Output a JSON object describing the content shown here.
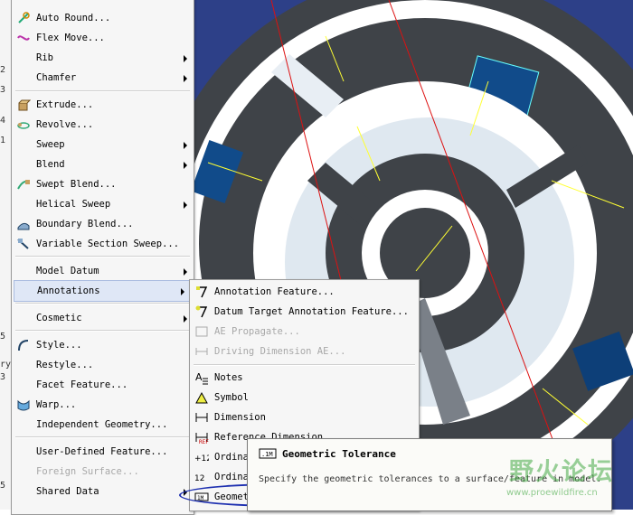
{
  "left_strip": {
    "fragments": [
      "2",
      "3",
      "4",
      "1",
      "5",
      "ry",
      "3",
      "5"
    ]
  },
  "main_menu": {
    "items": [
      {
        "label": "Auto Round...",
        "icon": "round-icon",
        "submenu": false
      },
      {
        "label": "Flex Move...",
        "icon": "flex-move-icon",
        "submenu": false
      },
      {
        "label": "Rib",
        "icon": "",
        "submenu": true
      },
      {
        "label": "Chamfer",
        "icon": "",
        "submenu": true
      },
      {
        "label": "Extrude...",
        "icon": "extrude-icon",
        "submenu": false
      },
      {
        "label": "Revolve...",
        "icon": "revolve-icon",
        "submenu": false
      },
      {
        "label": "Sweep",
        "icon": "",
        "submenu": true
      },
      {
        "label": "Blend",
        "icon": "",
        "submenu": true
      },
      {
        "label": "Swept Blend...",
        "icon": "swept-blend-icon",
        "submenu": false
      },
      {
        "label": "Helical Sweep",
        "icon": "",
        "submenu": true
      },
      {
        "label": "Boundary Blend...",
        "icon": "boundary-blend-icon",
        "submenu": false
      },
      {
        "label": "Variable Section Sweep...",
        "icon": "variable-sweep-icon",
        "submenu": false
      },
      {
        "label": "Model Datum",
        "icon": "",
        "submenu": true
      },
      {
        "label": "Annotations",
        "icon": "",
        "submenu": true,
        "highlighted": true
      },
      {
        "label": "Cosmetic",
        "icon": "",
        "submenu": true
      },
      {
        "label": "Style...",
        "icon": "style-icon",
        "submenu": false
      },
      {
        "label": "Restyle...",
        "icon": "",
        "submenu": false
      },
      {
        "label": "Facet Feature...",
        "icon": "",
        "submenu": false
      },
      {
        "label": "Warp...",
        "icon": "warp-icon",
        "submenu": false
      },
      {
        "label": "Independent Geometry...",
        "icon": "",
        "submenu": false
      },
      {
        "label": "User-Defined Feature...",
        "icon": "",
        "submenu": false
      },
      {
        "label": "Foreign Surface...",
        "icon": "",
        "submenu": false,
        "disabled": true
      },
      {
        "label": "Shared Data",
        "icon": "",
        "submenu": true
      }
    ]
  },
  "annotations_menu": {
    "items": [
      {
        "label": "Annotation Feature...",
        "icon": "annotation-feature-icon"
      },
      {
        "label": "Datum Target Annotation Feature...",
        "icon": "datum-target-icon"
      },
      {
        "label": "AE Propagate...",
        "icon": "ae-propagate-icon",
        "disabled": true
      },
      {
        "label": "Driving Dimension AE...",
        "icon": "driving-dimension-icon",
        "disabled": true
      },
      {
        "label": "Notes",
        "icon": "notes-icon"
      },
      {
        "label": "Symbol",
        "icon": "symbol-icon"
      },
      {
        "label": "Dimension",
        "icon": "dimension-icon"
      },
      {
        "label": "Reference Dimension",
        "icon": "reference-dimension-icon"
      },
      {
        "label": "Ordina",
        "icon": "ordinate-icon"
      },
      {
        "label": "Ordina",
        "icon": "ordinate-icon"
      },
      {
        "label": "Geometric Tolerance",
        "icon": "geometric-tolerance-icon",
        "circled": true
      }
    ]
  },
  "tooltip": {
    "title": "Geometric Tolerance",
    "description": "Specify the geometric tolerances to a surface/feature in model.",
    "icon": "geometric-tolerance-icon"
  },
  "watermark": {
    "text": "野火论坛",
    "url": "www.proewildfire.cn"
  },
  "colors": {
    "viewport_bg": "#2b3f86",
    "part_dark": "#3f4348",
    "part_light": "#e8eef4",
    "highlight": "#dfe7f6",
    "circle_mark": "#1d2fb0"
  }
}
